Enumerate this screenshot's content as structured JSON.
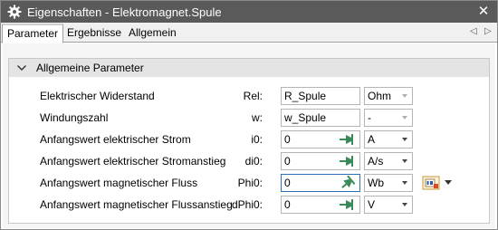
{
  "window": {
    "title": "Eigenschaften - Elektromagnet.Spule",
    "close_label": "✕"
  },
  "tabs": [
    {
      "label": "Parameter",
      "active": true
    },
    {
      "label": "Ergebnisse",
      "active": false
    },
    {
      "label": "Allgemein",
      "active": false
    }
  ],
  "group": {
    "title": "Allgemeine Parameter",
    "expanded": true
  },
  "parameters": [
    {
      "label": "Elektrischer Widerstand",
      "symbol": "Rel:",
      "value": "R_Spule",
      "unit": "Ohm",
      "unit_enabled": false,
      "pin": false
    },
    {
      "label": "Windungszahl",
      "symbol": "w:",
      "value": "w_Spule",
      "unit": "-",
      "unit_enabled": false,
      "pin": false
    },
    {
      "label": "Anfangswert elektrischer Strom",
      "symbol": "i0:",
      "value": "0",
      "unit": "A",
      "unit_enabled": true,
      "pin": true
    },
    {
      "label": "Anfangswert elektrischer Stromanstieg",
      "symbol": "di0:",
      "value": "0",
      "unit": "A/s",
      "unit_enabled": true,
      "pin": true
    },
    {
      "label": "Anfangswert magnetischer Fluss",
      "symbol": "Phi0:",
      "value": "0",
      "unit": "Wb",
      "unit_enabled": true,
      "pin": true
    },
    {
      "label": "Anfangswert magnetischer Flussanstieg",
      "symbol": "dPhi0:",
      "value": "0",
      "unit": "V",
      "unit_enabled": true,
      "pin": true
    }
  ],
  "colors": {
    "titlebar": "#5a5a5a",
    "group_header": "#e4e4e4",
    "pin_green": "#3a8a5a",
    "focus_border": "#2f6fb7"
  },
  "icons": {
    "title": "gear-icon",
    "close": "close-icon",
    "group_toggle": "chevron-down-icon",
    "pin": "pin-icon",
    "extra": "formula-icon"
  }
}
